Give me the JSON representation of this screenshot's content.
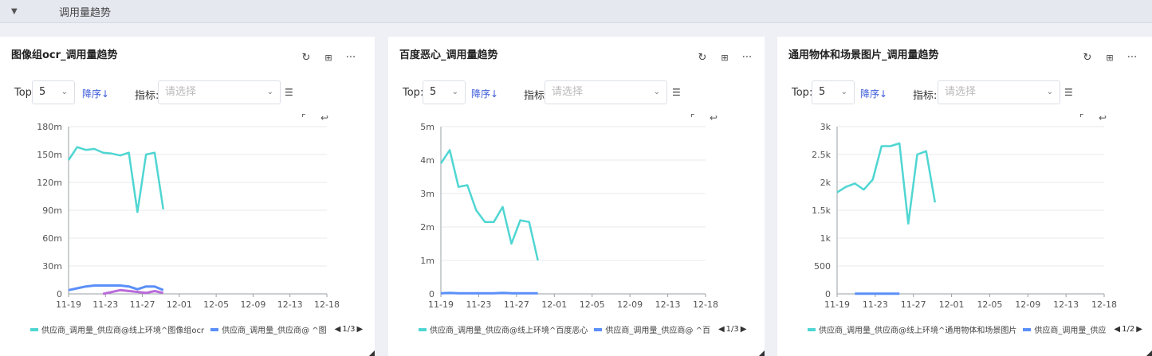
{
  "section": {
    "title": "调用量趋势"
  },
  "colors": {
    "teal": "#4fd6d2",
    "blue": "#5b8ff9",
    "purple": "#b96bd9",
    "accent": "#3a5ad9"
  },
  "panels": [
    {
      "title": "图像组ocr_调用量趋势",
      "top_label": "Top:",
      "top_value": "5",
      "sort_label": "降序",
      "metric_label": "指标:",
      "metric_placeholder": "请选择",
      "legend": [
        "供应商_调用量_供应商@线上环境^图像组ocr",
        "供应商_调用量_供应商@ ^图"
      ],
      "pager": "1/3",
      "chart": {
        "yticks": [
          "0",
          "30m",
          "60m",
          "90m",
          "120m",
          "150m",
          "180m"
        ],
        "ymax": 180,
        "xticks": [
          "11-19",
          "11-23",
          "11-27",
          "12-01",
          "12-05",
          "12-09",
          "12-13",
          "12-18"
        ],
        "series": [
          {
            "name": "供应商_调用量_供应商@线上环境^图像组ocr",
            "color": "teal",
            "x": [
              0,
              1,
              2,
              3,
              4,
              5,
              6,
              7,
              8,
              9,
              10,
              11,
              12
            ],
            "y": [
              144,
              158,
              155,
              156,
              152,
              151,
              149,
              152,
              88,
              150,
              152,
              91,
              null
            ]
          },
          {
            "name": "供应商_调用量_供应商@ ^图",
            "color": "blue",
            "x": [
              0,
              1,
              2,
              3,
              4,
              5,
              6,
              7,
              8,
              9,
              10,
              11,
              12
            ],
            "y": [
              4,
              6,
              8,
              9,
              9,
              9,
              9,
              8,
              5,
              8,
              8,
              4,
              null
            ]
          },
          {
            "name": "",
            "color": "purple",
            "x": [
              4,
              5,
              6,
              9,
              10,
              11
            ],
            "y": [
              0,
              2,
              4,
              1,
              3,
              1
            ]
          }
        ],
        "xlen": 30
      }
    },
    {
      "title": "百度恶心_调用量趋势",
      "top_label": "Top:",
      "top_value": "5",
      "sort_label": "降序",
      "metric_label": "指标:",
      "metric_placeholder": "请选择",
      "legend": [
        "供应商_调用量_供应商@线上环境^百度恶心",
        "供应商_调用量_供应商@ ^百"
      ],
      "pager": "1/3",
      "chart": {
        "yticks": [
          "0",
          "1m",
          "2m",
          "3m",
          "4m",
          "5m"
        ],
        "ymax": 5,
        "xticks": [
          "11-19",
          "11-23",
          "11-27",
          "12-01",
          "12-05",
          "12-09",
          "12-13",
          "12-18"
        ],
        "series": [
          {
            "name": "供应商_调用量_供应商@线上环境^百度恶心",
            "color": "teal",
            "x": [
              0,
              1,
              2,
              3,
              4,
              5,
              6,
              7,
              8,
              9,
              10,
              11
            ],
            "y": [
              3.9,
              4.3,
              3.2,
              3.25,
              2.5,
              2.15,
              2.15,
              2.6,
              1.5,
              2.2,
              2.15,
              1.0
            ]
          },
          {
            "name": "供应商_调用量_供应商@ ^百",
            "color": "blue",
            "x": [
              0,
              1,
              2,
              3,
              4,
              5,
              6,
              7,
              8,
              9,
              10,
              11
            ],
            "y": [
              0.02,
              0.03,
              0.02,
              0.02,
              0.02,
              0.02,
              0.02,
              0.03,
              0.02,
              0.02,
              0.02,
              0.02
            ]
          }
        ],
        "xlen": 30
      }
    },
    {
      "title": "通用物体和场景图片_调用量趋势",
      "top_label": "Top:",
      "top_value": "5",
      "sort_label": "降序",
      "metric_label": "指标:",
      "metric_placeholder": "请选择",
      "legend": [
        "供应商_调用量_供应商@线上环境^通用物体和场景图片",
        "供应商_调用量_供应"
      ],
      "pager": "1/2",
      "chart": {
        "yticks": [
          "0",
          "500",
          "1k",
          "1.5k",
          "2k",
          "2.5k",
          "3k"
        ],
        "ymax": 3000,
        "xticks": [
          "11-19",
          "11-23",
          "11-27",
          "12-01",
          "12-05",
          "12-09",
          "12-13",
          "12-18"
        ],
        "series": [
          {
            "name": "供应商_调用量_供应商@线上环境^通用物体和场景图片",
            "color": "teal",
            "x": [
              0,
              1,
              2,
              3,
              4,
              5,
              6,
              7,
              8,
              9,
              10,
              11
            ],
            "y": [
              1820,
              1920,
              1980,
              1870,
              2050,
              2650,
              2650,
              2700,
              1260,
              2500,
              2560,
              1640
            ]
          },
          {
            "name": "供应商_调用量_供应",
            "color": "blue",
            "x": [
              2,
              7
            ],
            "y": [
              5,
              5
            ]
          }
        ],
        "xlen": 30
      }
    }
  ]
}
